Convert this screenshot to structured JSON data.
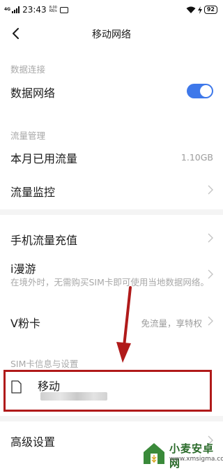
{
  "status_bar": {
    "network": "4G",
    "time": "23:43",
    "speed_value": "8.00",
    "speed_unit": "KB/s",
    "battery": "92"
  },
  "header": {
    "title": "移动网络"
  },
  "data_connection": {
    "section_title": "数据连接",
    "data_network_label": "数据网络",
    "data_network_on": true
  },
  "traffic": {
    "section_title": "流量管理",
    "monthly_usage_label": "本月已用流量",
    "monthly_usage_value": "1.10GB",
    "monitor_label": "流量监控"
  },
  "services": {
    "recharge_label": "手机流量充值",
    "roaming_label": "i漫游",
    "roaming_desc": "在境外时，无需购买SIM卡即可使用当地数据网络。",
    "vcard_label": "V粉卡",
    "vcard_value": "免流量，享特权"
  },
  "sim": {
    "section_title": "SIM卡信息与设置",
    "carrier_label": "移动"
  },
  "advanced": {
    "label": "高级设置"
  },
  "watermark": {
    "title": "小麦安卓网",
    "url": "www.xmsigma.com"
  },
  "colors": {
    "accent": "#3e78ea",
    "highlight_box": "#b01a1a"
  }
}
